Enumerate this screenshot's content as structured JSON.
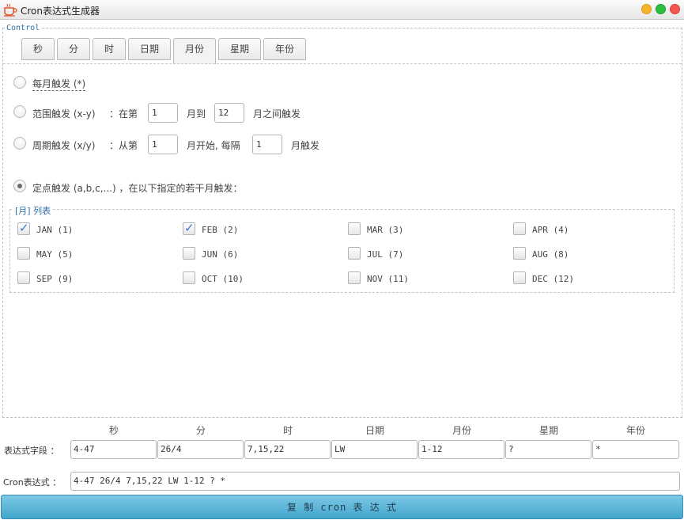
{
  "window": {
    "title": "Cron表达式生成器",
    "controls": [
      "minimize",
      "maximize",
      "close"
    ],
    "colors": {
      "minimize": "#f6b42a",
      "maximize": "#2bc03f",
      "close": "#f25a51"
    }
  },
  "control": {
    "legend": "Control",
    "tabs": [
      {
        "label": "秒",
        "active": false
      },
      {
        "label": "分",
        "active": false
      },
      {
        "label": "时",
        "active": false
      },
      {
        "label": "日期",
        "active": false
      },
      {
        "label": "月份",
        "active": true
      },
      {
        "label": "星期",
        "active": false
      },
      {
        "label": "年份",
        "active": false
      }
    ],
    "options": {
      "every": {
        "label": "每月触发 (*)",
        "selected": false
      },
      "range": {
        "label": "范围触发 (x-y)",
        "text_start": "：在第",
        "from_value": "1",
        "text_mid": "月到",
        "to_value": "12",
        "text_end": "月之间触发",
        "selected": false
      },
      "cycle": {
        "label": "周期触发 (x/y)",
        "text_start": "：从第",
        "start_value": "1",
        "text_mid": "月开始, 每隔",
        "interval_value": "1",
        "text_end": "月触发",
        "selected": false
      },
      "specific": {
        "label": "定点触发 (a,b,c,...) ，在以下指定的若干月触发：",
        "selected": true
      }
    },
    "month_list": {
      "legend": "[月] 列表",
      "months": [
        {
          "label": "JAN (1)",
          "checked": true
        },
        {
          "label": "FEB (2)",
          "checked": true
        },
        {
          "label": "MAR (3)",
          "checked": false
        },
        {
          "label": "APR (4)",
          "checked": false
        },
        {
          "label": "MAY (5)",
          "checked": false
        },
        {
          "label": "JUN (6)",
          "checked": false
        },
        {
          "label": "JUL (7)",
          "checked": false
        },
        {
          "label": "AUG (8)",
          "checked": false
        },
        {
          "label": "SEP (9)",
          "checked": false
        },
        {
          "label": "OCT (10)",
          "checked": false
        },
        {
          "label": "NOV (11)",
          "checked": false
        },
        {
          "label": "DEC (12)",
          "checked": false
        }
      ]
    }
  },
  "expression": {
    "headers": [
      "秒",
      "分",
      "时",
      "日期",
      "月份",
      "星期",
      "年份"
    ],
    "fields_label": "表达式字段 ：",
    "fields": [
      "4-47",
      "26/4",
      "7,15,22",
      "LW",
      "1-12",
      "?",
      "*"
    ],
    "cron_label": "Cron表达式 ：",
    "cron_value": "4-47 26/4 7,15,22 LW 1-12 ? *"
  },
  "copy_button": {
    "label": "复 制 cron 表 达 式"
  }
}
